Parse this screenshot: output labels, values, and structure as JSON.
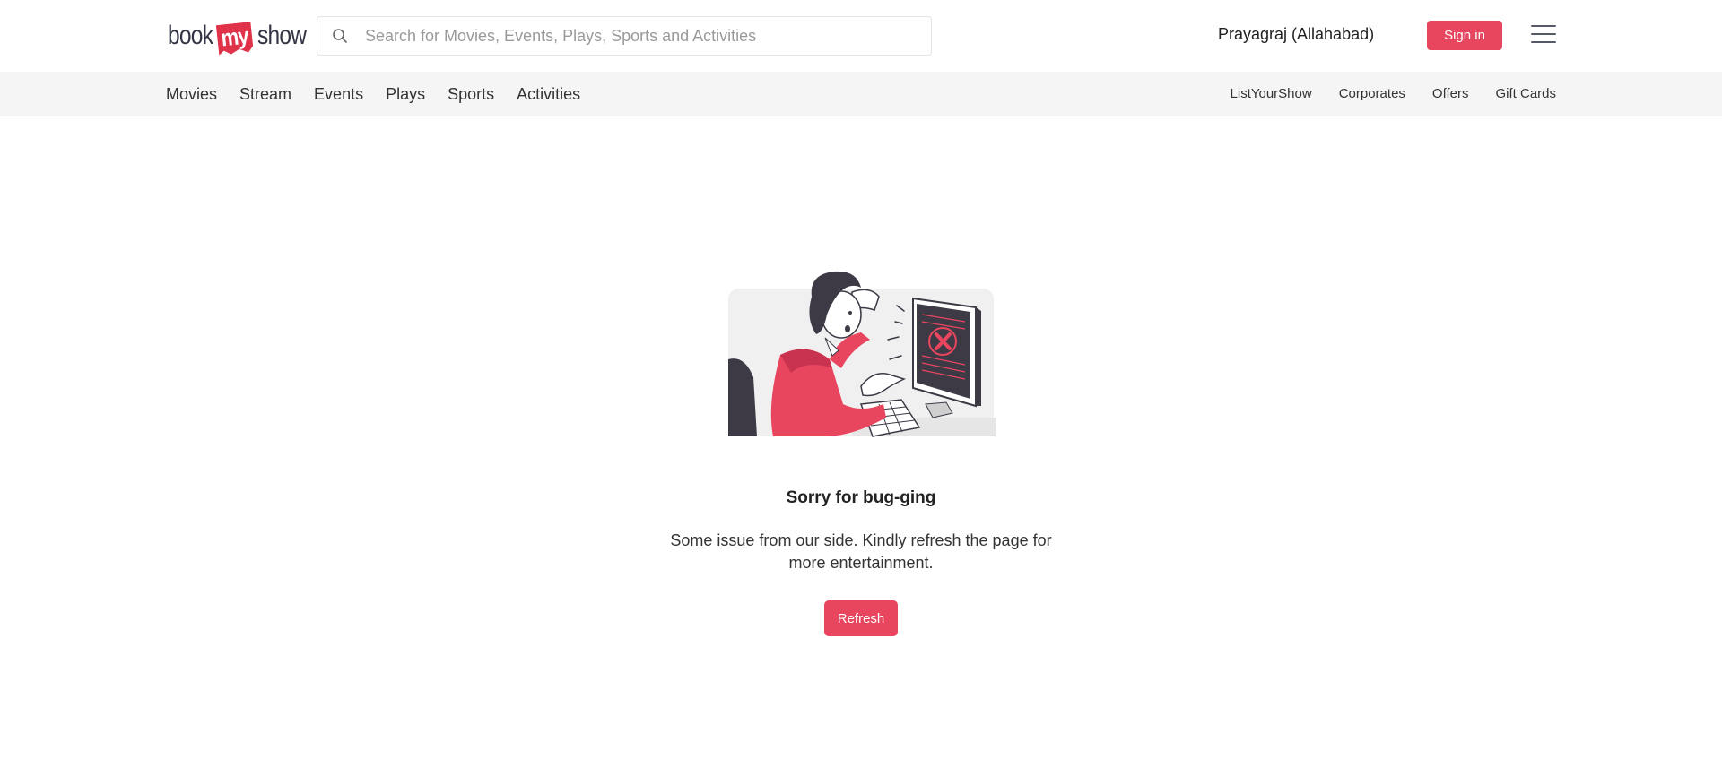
{
  "header": {
    "logo": {
      "part1": "book",
      "part2": "my",
      "part3": "show"
    },
    "search": {
      "placeholder": "Search for Movies, Events, Plays, Sports and Activities",
      "icon": "search-icon"
    },
    "city": "Prayagraj (Allahabad)",
    "sign_in_label": "Sign in",
    "menu_icon": "hamburger-menu-icon"
  },
  "nav": {
    "left_items": [
      {
        "label": "Movies"
      },
      {
        "label": "Stream"
      },
      {
        "label": "Events"
      },
      {
        "label": "Plays"
      },
      {
        "label": "Sports"
      },
      {
        "label": "Activities"
      }
    ],
    "right_items": [
      {
        "label": "ListYourShow"
      },
      {
        "label": "Corporates"
      },
      {
        "label": "Offers"
      },
      {
        "label": "Gift Cards"
      }
    ]
  },
  "error": {
    "illustration": "frustrated-person-at-computer-illustration",
    "title": "Sorry for bug-ging",
    "message": "Some issue from our side. Kindly refresh the page for more entertainment.",
    "refresh_label": "Refresh"
  },
  "colors": {
    "brand": "#e8465f",
    "nav_background": "#f5f5f5",
    "text": "#333333"
  }
}
